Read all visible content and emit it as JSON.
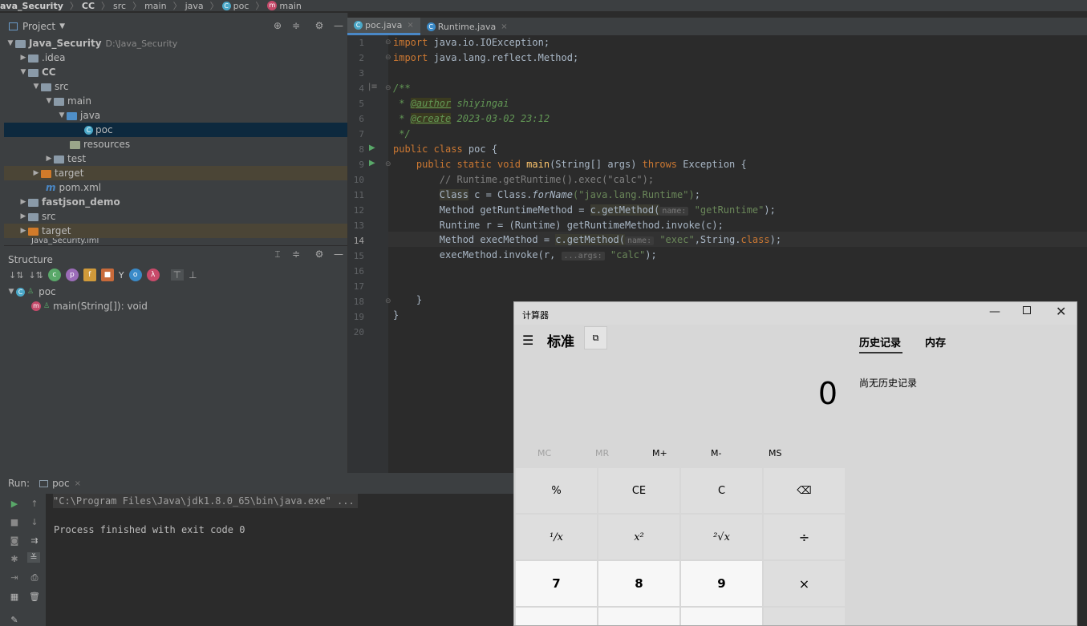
{
  "breadcrumb": {
    "items": [
      "ava_Security",
      "CC",
      "src",
      "main",
      "java",
      "poc",
      "main"
    ]
  },
  "project": {
    "title": "Project",
    "tree": [
      {
        "label": "Java_Security",
        "path": "D:\\Java_Security"
      },
      {
        "label": ".idea"
      },
      {
        "label": "CC"
      },
      {
        "label": "src"
      },
      {
        "label": "main"
      },
      {
        "label": "java"
      },
      {
        "label": "poc"
      },
      {
        "label": "resources"
      },
      {
        "label": "test"
      },
      {
        "label": "target"
      },
      {
        "label": "pom.xml"
      },
      {
        "label": "fastjson_demo"
      },
      {
        "label": "src"
      },
      {
        "label": "target"
      },
      {
        "label": "Java_Security.iml"
      }
    ]
  },
  "structure": {
    "title": "Structure",
    "class_label": "poc",
    "method_label": "main(String[]): void"
  },
  "tabs": [
    {
      "label": "poc.java"
    },
    {
      "label": "Runtime.java"
    }
  ],
  "editor": {
    "line_numbers": [
      "1",
      "2",
      "3",
      "4",
      "5",
      "6",
      "7",
      "8",
      "9",
      "10",
      "11",
      "12",
      "13",
      "14",
      "15",
      "16",
      "17",
      "18",
      "19",
      "20"
    ],
    "lines": {
      "l1_kw": "import",
      "l1_rest": " java.io.IOException;",
      "l2_kw": "import",
      "l2_rest": " java.lang.reflect.Method;",
      "l4": "/**",
      "l5_star": " * ",
      "l5_tag": "@author",
      "l5_val": " shiyingai",
      "l6_star": " * ",
      "l6_tag": "@create",
      "l6_val": " 2023-03-02 23:12",
      "l7": " */",
      "l8_kw": "public class",
      "l8_rest": " poc {",
      "l9_kw1": "    public static void ",
      "l9_fn": "main",
      "l9_mid": "(String[] args) ",
      "l9_kw2": "throws",
      "l9_rest": " Exception {",
      "l10": "        // Runtime.getRuntime().exec(\"calc\");",
      "l11_pre": "        ",
      "l11_cls": "Class",
      "l11_mid": " c = Class.",
      "l11_fn": "forName",
      "l11_str": "(\"java.lang.Runtime\")",
      "l11_end": ";",
      "l12_pre": "        Method getRuntimeMethod = ",
      "l12_hl": "c.getMethod(",
      "l12_hint": "name:",
      "l12_str": " \"getRuntime\"",
      "l12_end": ");",
      "l13": "        Runtime r = (Runtime) getRuntimeMethod.invoke(c);",
      "l14_pre": "        Method execMethod = ",
      "l14_hl": "c.getMethod(",
      "l14_hint": "name:",
      "l14_str": " \"exec\"",
      "l14_mid": ",String.",
      "l14_kw": "class",
      "l14_end": ");",
      "l15_pre": "        execMethod.invoke(r, ",
      "l15_hint": "...args:",
      "l15_str": " \"calc\"",
      "l15_end": ");",
      "l18": "    }",
      "l19": "}"
    }
  },
  "run": {
    "label": "Run:",
    "tab": "poc",
    "output": [
      "\"C:\\Program Files\\Java\\jdk1.8.0_65\\bin\\java.exe\" ...",
      "Process finished with exit code 0"
    ]
  },
  "calculator": {
    "title": "计算器",
    "mode": "标准",
    "display": "0",
    "memory": [
      "MC",
      "MR",
      "M+",
      "M-",
      "MS"
    ],
    "keys": [
      "%",
      "CE",
      "C",
      "⌫",
      "¹/x",
      "x²",
      "²√x",
      "÷",
      "7",
      "8",
      "9",
      "×"
    ],
    "history_tab": "历史记录",
    "memory_tab": "内存",
    "history_empty": "尚无历史记录"
  },
  "colors": {
    "accent": "#4a88c7",
    "keyword": "#cc7832",
    "string": "#6a8759",
    "doc": "#629755"
  }
}
